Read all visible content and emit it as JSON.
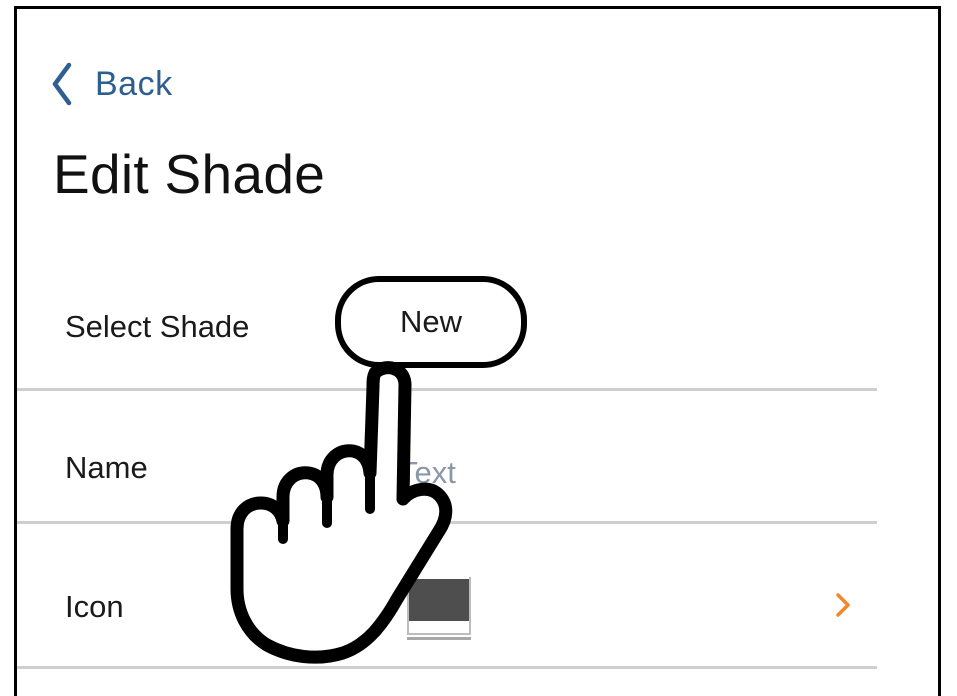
{
  "header": {
    "back_label": "Back",
    "title": "Edit Shade"
  },
  "form": {
    "select_shade": {
      "label": "Select Shade",
      "value": "New"
    },
    "name": {
      "label": "Name",
      "placeholder": "Text"
    },
    "icon": {
      "label": "Icon",
      "swatch_color": "#4e4e4e"
    }
  },
  "colors": {
    "back_link": "#2e5f8e",
    "chevron_accent": "#f0892b",
    "divider": "#cfcfcf"
  },
  "icons": {
    "back": "chevron-left-icon",
    "row_disclosure": "chevron-right-icon",
    "pointer": "pointing-hand-icon"
  }
}
